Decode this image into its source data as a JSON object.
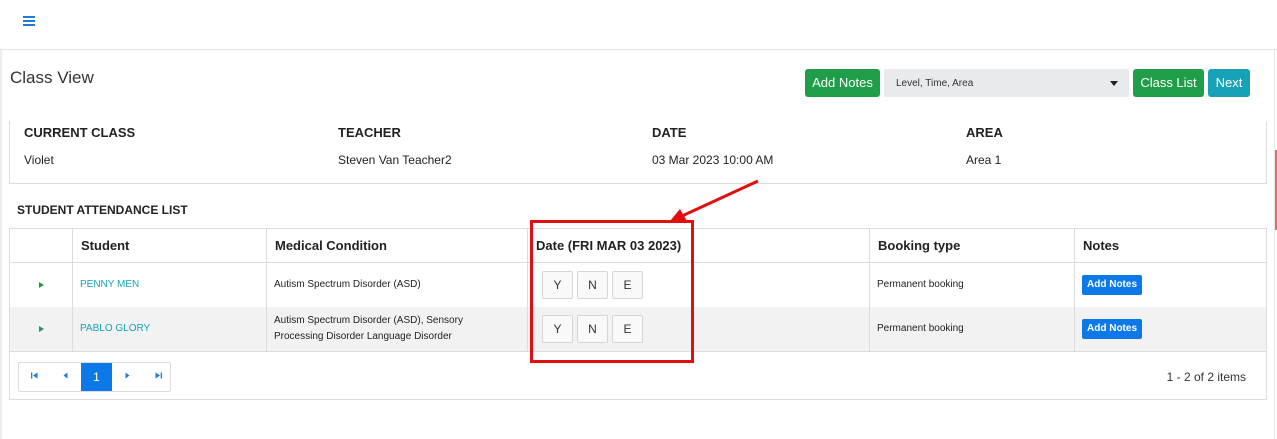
{
  "topbar": {
    "menu_icon": "hamburger-menu-icon"
  },
  "page": {
    "title": "Class View"
  },
  "toolbar": {
    "add_notes_label": "Add Notes",
    "filter_select_value": "Level, Time, Area",
    "class_list_label": "Class List",
    "next_label": "Next"
  },
  "class_info": {
    "current_class_label": "CURRENT CLASS",
    "current_class_value": "Violet",
    "teacher_label": "TEACHER",
    "teacher_value": "Steven Van Teacher2",
    "date_label": "DATE",
    "date_value": "03 Mar 2023 10:00 AM",
    "area_label": "AREA",
    "area_value": "Area 1"
  },
  "attendance": {
    "section_title": "STUDENT ATTENDANCE LIST",
    "columns": [
      "Student",
      "Medical Condition",
      "Date (FRI MAR 03 2023)",
      "Booking type",
      "Notes"
    ],
    "rows": [
      {
        "student": "PENNY MEN",
        "medical_condition": "Autism Spectrum Disorder (ASD)",
        "attendance_options": [
          "Y",
          "N",
          "E"
        ],
        "booking_type": "Permanent booking",
        "notes_button": "Add Notes"
      },
      {
        "student": "PABLO GLORY",
        "medical_condition": "Autism Spectrum Disorder (ASD), Sensory Processing Disorder Language Disorder",
        "attendance_options": [
          "Y",
          "N",
          "E"
        ],
        "booking_type": "Permanent booking",
        "notes_button": "Add Notes"
      }
    ]
  },
  "pager": {
    "first_icon": "first-page-icon",
    "prev_icon": "previous-page-icon",
    "current_page": "1",
    "next_icon": "next-page-icon",
    "last_icon": "last-page-icon",
    "items_text": "1 - 2 of 2 items"
  },
  "colors": {
    "green": "#1f9d48",
    "teal": "#17a2b8",
    "blue": "#0d79e8",
    "annotation_red": "#e01010"
  }
}
